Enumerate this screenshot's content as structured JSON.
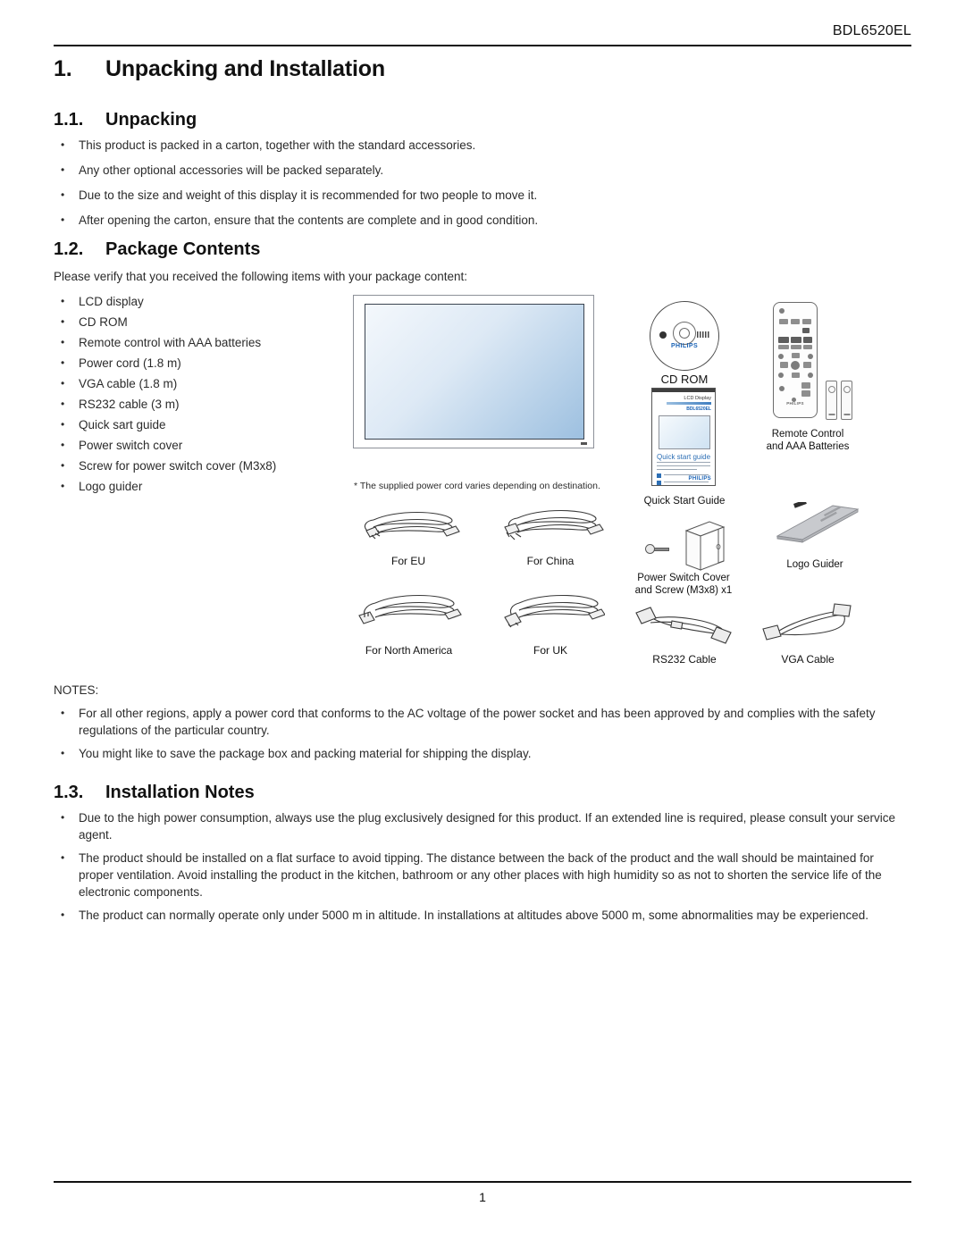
{
  "header": {
    "model": "BDL6520EL"
  },
  "footer": {
    "page_number": "1"
  },
  "section1": {
    "number": "1.",
    "title": "Unpacking and Installation"
  },
  "section11": {
    "number": "1.1.",
    "title": "Unpacking",
    "bullets": [
      "This product is packed in a carton, together with the standard accessories.",
      "Any other optional accessories will be packed separately.",
      "Due to the size and weight of this display it is recommended for two people to move it.",
      "After opening the carton, ensure that the contents are complete and in good condition."
    ]
  },
  "section12": {
    "number": "1.2.",
    "title": "Package Contents",
    "intro": "Please verify that you received the following items with your package content:",
    "items": [
      "LCD display",
      "CD ROM",
      "Remote control with AAA batteries",
      "Power cord (1.8 m)",
      "VGA cable (1.8 m)",
      "RS232 cable (3 m)",
      "Quick sart guide",
      "Power switch cover",
      "Screw for power switch cover (M3x8)",
      "Logo guider"
    ],
    "footnote": "* The supplied power cord varies depending on destination.",
    "figure_captions": {
      "cd_rom": "CD ROM",
      "remote": "Remote Control\nand AAA Batteries",
      "remote_line1": "Remote Control",
      "remote_line2": "and AAA Batteries",
      "quick_start_guide": "Quick Start Guide",
      "power_switch_line1": "Power Switch Cover",
      "power_switch_line2": "and Screw (M3x8) x1",
      "logo_guider": "Logo Guider",
      "cord_eu": "For EU",
      "cord_china": "For China",
      "cord_north_america": "For North America",
      "cord_uk": "For UK",
      "rs232_cable": "RS232 Cable",
      "vga_cable": "VGA Cable"
    },
    "booklet": {
      "title": "LCD Display",
      "model": "BDL6520EL",
      "heading": "Quick start guide",
      "brand": "PHILIPS"
    },
    "cd_brand": "PHILIPS",
    "remote_brand": "PHILIPS"
  },
  "notes": {
    "label": "NOTES:",
    "bullets": [
      "For all other regions, apply a power cord that conforms to the AC voltage of the power socket and has been approved by and complies with the safety regulations of the particular country.",
      "You might like to save the package box and packing material for shipping the display."
    ]
  },
  "section13": {
    "number": "1.3.",
    "title": "Installation Notes",
    "bullets": [
      "Due to the high power consumption, always use the plug exclusively designed for this product. If an extended line is required, please consult your service agent.",
      "The product should be installed on a flat surface to avoid tipping. The distance between the back of the product and the wall should be maintained for proper ventilation. Avoid installing the product in the kitchen, bathroom or any other places with high humidity so as not to shorten the service life of the electronic components.",
      "The product can normally operate only under 5000 m in altitude. In installations at altitudes above 5000 m, some abnormalities may be experienced."
    ]
  },
  "colors": {
    "brand_blue": "#1a62b5",
    "screen_blue": "#9dc0e0",
    "text": "#2b2b2b"
  }
}
